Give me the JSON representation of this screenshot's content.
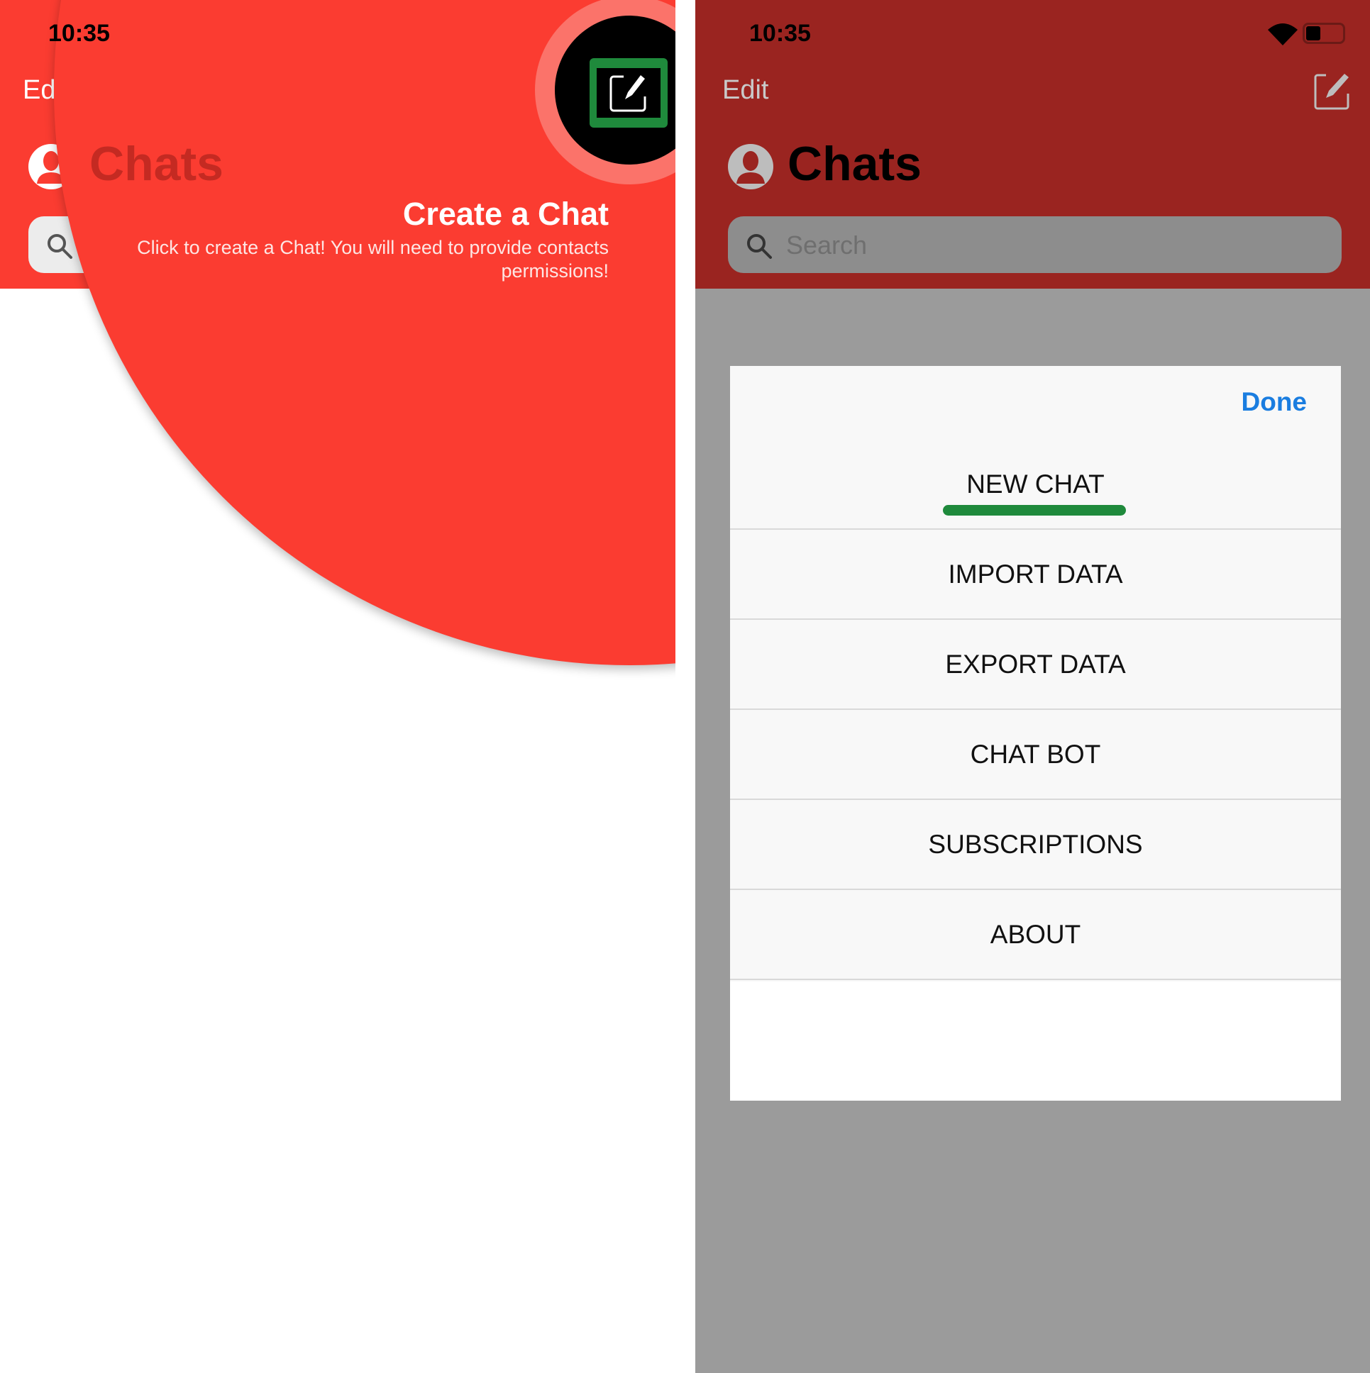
{
  "left_screen": {
    "status_time": "10:35",
    "edit_label": "Edit",
    "title": "Chats",
    "tooltip": {
      "title": "Create a Chat",
      "description": "Click to create a Chat! You will need to provide contacts permissions!"
    },
    "highlight_color": "#1f8a3c",
    "accent_color": "#fb3c31"
  },
  "right_screen": {
    "status_time": "10:35",
    "edit_label": "Edit",
    "title": "Chats",
    "search_placeholder": "Search",
    "menu": {
      "done_label": "Done",
      "items": [
        {
          "label": "NEW CHAT",
          "highlighted": true
        },
        {
          "label": "IMPORT DATA"
        },
        {
          "label": "EXPORT DATA"
        },
        {
          "label": "CHAT BOT"
        },
        {
          "label": "SUBSCRIPTIONS"
        },
        {
          "label": "ABOUT"
        }
      ]
    },
    "done_color": "#1a7de0"
  }
}
